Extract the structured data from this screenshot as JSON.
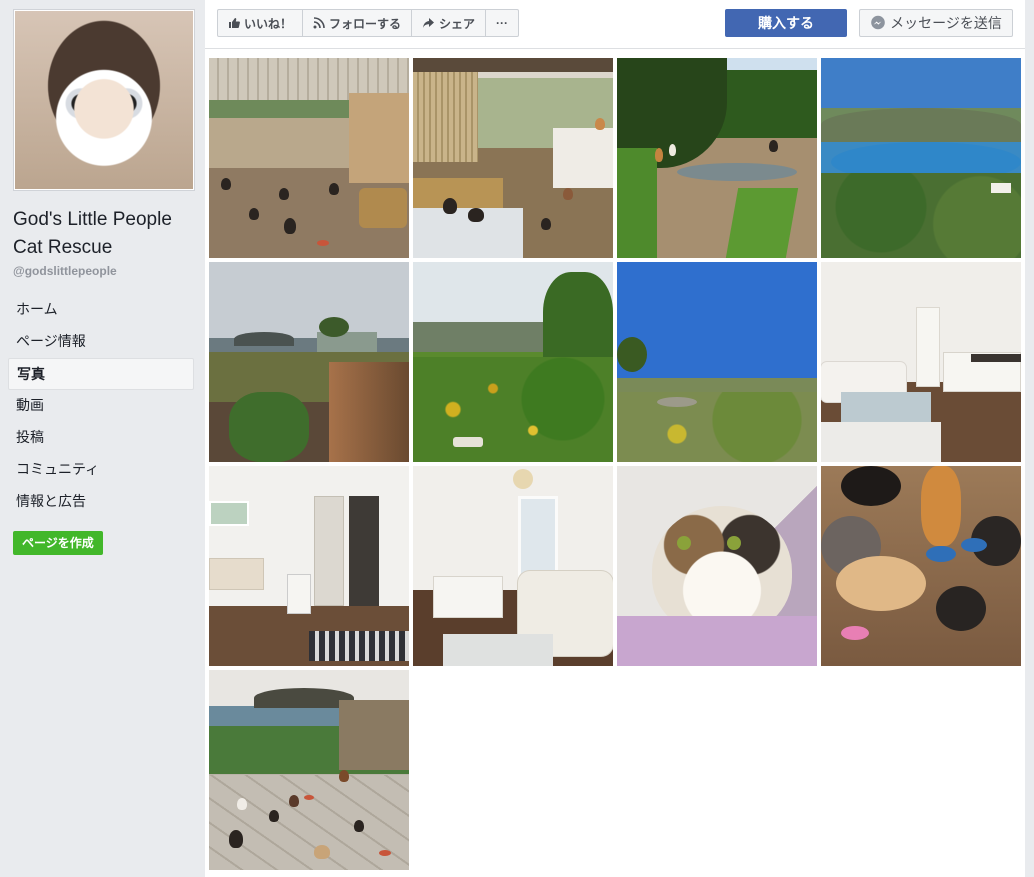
{
  "page": {
    "name": "God's Little People Cat Rescue",
    "handle": "@godslittlepeople"
  },
  "nav": {
    "items": [
      {
        "label": "ホーム",
        "active": false
      },
      {
        "label": "ページ情報",
        "active": false
      },
      {
        "label": "写真",
        "active": true
      },
      {
        "label": "動画",
        "active": false
      },
      {
        "label": "投稿",
        "active": false
      },
      {
        "label": "コミュニティ",
        "active": false
      },
      {
        "label": "情報と広告",
        "active": false
      }
    ],
    "create_page": "ページを作成"
  },
  "toolbar": {
    "like": "いいね！",
    "follow": "フォローする",
    "share": "シェア",
    "more": "···",
    "buy": "購入する",
    "message": "メッセージを送信"
  },
  "colors": {
    "brand_blue": "#4267b2",
    "create_green": "#42b72a",
    "background": "#e9ebee"
  },
  "photos": [
    {
      "scene": "porch-cats",
      "icon": "photo"
    },
    {
      "scene": "shed-cats",
      "icon": "photo"
    },
    {
      "scene": "dirt-path-cats",
      "icon": "photo"
    },
    {
      "scene": "bay-view",
      "icon": "photo"
    },
    {
      "scene": "garden-sunset",
      "icon": "photo"
    },
    {
      "scene": "wild-garden",
      "icon": "photo"
    },
    {
      "scene": "coast-hills",
      "icon": "photo"
    },
    {
      "scene": "living-room",
      "icon": "photo"
    },
    {
      "scene": "kitchen-hall",
      "icon": "photo"
    },
    {
      "scene": "bedroom-lounge",
      "icon": "photo"
    },
    {
      "scene": "cat-portrait",
      "icon": "photo"
    },
    {
      "scene": "cats-eating",
      "icon": "photo"
    },
    {
      "scene": "terrace-cats",
      "icon": "photo"
    }
  ]
}
